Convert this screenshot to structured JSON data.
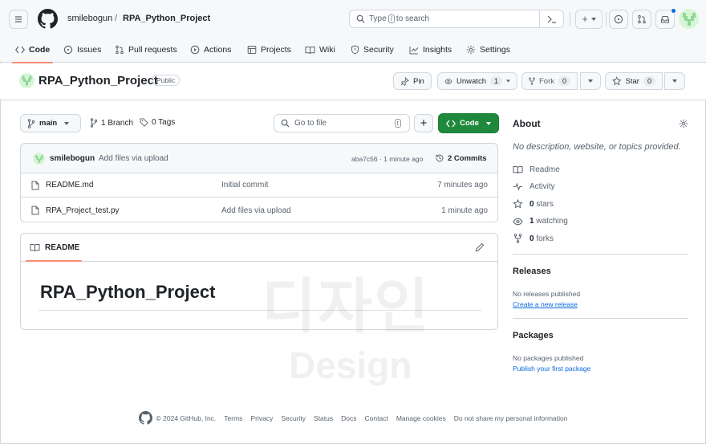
{
  "header": {
    "owner": "smilebogun",
    "separator": "/",
    "repo": "RPA_Python_Project",
    "search_pre": "Type",
    "search_key": "/",
    "search_post": "to search",
    "add_label": "+",
    "tabs": [
      {
        "label": "Code",
        "icon": "code-icon"
      },
      {
        "label": "Issues",
        "icon": "issue-icon"
      },
      {
        "label": "Pull requests",
        "icon": "pull-request-icon"
      },
      {
        "label": "Actions",
        "icon": "play-icon"
      },
      {
        "label": "Projects",
        "icon": "table-icon"
      },
      {
        "label": "Wiki",
        "icon": "book-icon"
      },
      {
        "label": "Security",
        "icon": "shield-icon"
      },
      {
        "label": "Insights",
        "icon": "graph-icon"
      },
      {
        "label": "Settings",
        "icon": "gear-icon"
      }
    ]
  },
  "repo": {
    "name": "RPA_Python_Project",
    "visibility": "Public",
    "pin": "Pin",
    "unwatch": "Unwatch",
    "watch_count": "1",
    "fork": "Fork",
    "fork_count": "0",
    "star": "Star",
    "star_count": "0"
  },
  "toolbar": {
    "branch": "main",
    "branches": "1 Branch",
    "tags": "0 Tags",
    "go_to_file": "Go to file",
    "go_key": "t",
    "add": "+",
    "code": "Code"
  },
  "commit": {
    "author": "smilebogun",
    "message": "Add files via upload",
    "hash_time": "aba7c56 · 1 minute ago",
    "commits": "2 Commits"
  },
  "files": [
    {
      "name": "README.md",
      "message": "Initial commit",
      "time": "7 minutes ago"
    },
    {
      "name": "RPA_Project_test.py",
      "message": "Add files via upload",
      "time": "1 minute ago"
    }
  ],
  "readme": {
    "tab": "README",
    "heading": "RPA_Python_Project"
  },
  "about": {
    "title": "About",
    "description": "No description, website, or topics provided.",
    "items": [
      {
        "label": "Readme",
        "icon": "book-icon"
      },
      {
        "label": "Activity",
        "icon": "pulse-icon"
      },
      {
        "bold": "0",
        "label": "stars",
        "icon": "star-icon"
      },
      {
        "bold": "1",
        "label": "watching",
        "icon": "eye-icon"
      },
      {
        "bold": "0",
        "label": "forks",
        "icon": "fork-icon"
      }
    ],
    "releases_title": "Releases",
    "releases_text": "No releases published",
    "releases_link": "Create a new release",
    "packages_title": "Packages",
    "packages_text": "No packages published",
    "packages_link": "Publish your first package"
  },
  "footer": {
    "copyright": "© 2024 GitHub, Inc.",
    "links": [
      "Terms",
      "Privacy",
      "Security",
      "Status",
      "Docs",
      "Contact",
      "Manage cookies",
      "Do not share my personal information"
    ]
  },
  "watermark": {
    "korean": "디자인",
    "english": "Design"
  },
  "colors": {
    "accent": "#1f883d",
    "link": "#0969da",
    "tab_underline": "#fd8c73"
  }
}
